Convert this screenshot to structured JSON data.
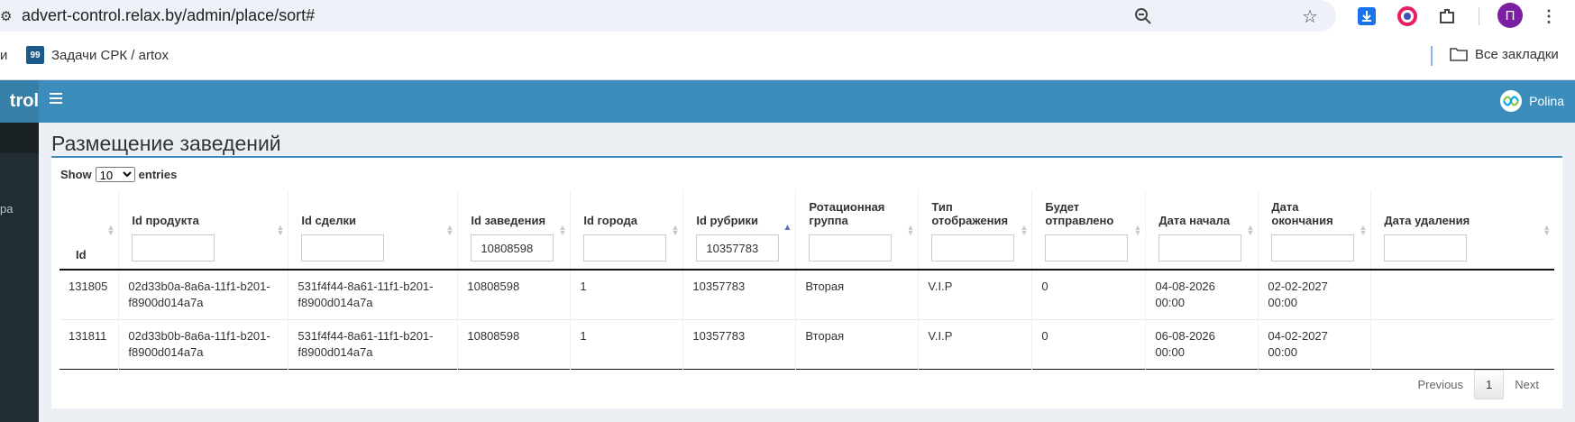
{
  "browser": {
    "url": "advert-control.relax.by/admin/place/sort#",
    "profile_initial": "П",
    "bookmarks": {
      "prev_fragment": "и",
      "item_label": "Задачи СРК / artox",
      "item_favicon_text": "99",
      "all_label": "Все закладки"
    }
  },
  "app": {
    "logo_fragment": "trol",
    "user_name": "Polina",
    "sidebar_item_fragment": "ра"
  },
  "page": {
    "title": "Размещение заведений",
    "show_label": "Show",
    "entries_label": "entries",
    "page_length": "10"
  },
  "table": {
    "headers": [
      {
        "label": "Id"
      },
      {
        "label": "Id продукта",
        "filter": ""
      },
      {
        "label": "Id сделки",
        "filter": ""
      },
      {
        "label": "Id заведения",
        "filter": "10808598"
      },
      {
        "label": "Id города",
        "filter": ""
      },
      {
        "label": "Id рубрики",
        "filter": "10357783"
      },
      {
        "label": "Ротационная группа",
        "filter": ""
      },
      {
        "label": "Тип отображения",
        "filter": ""
      },
      {
        "label": "Будет отправлено",
        "filter": ""
      },
      {
        "label": "Дата начала",
        "filter": ""
      },
      {
        "label": "Дата окончания",
        "filter": ""
      },
      {
        "label": "Дата удаления",
        "filter": ""
      }
    ],
    "rows": [
      [
        "131805",
        "02d33b0a-8a6a-11f1-b201-f8900d014a7a",
        "531f4f44-8a61-11f1-b201-f8900d014a7a",
        "10808598",
        "1",
        "10357783",
        "Вторая",
        "V.I.P",
        "0",
        "04-08-2026 00:00",
        "02-02-2027 00:00",
        ""
      ],
      [
        "131811",
        "02d33b0b-8a6a-11f1-b201-f8900d014a7a",
        "531f4f44-8a61-11f1-b201-f8900d014a7a",
        "10808598",
        "1",
        "10357783",
        "Вторая",
        "V.I.P",
        "0",
        "06-08-2026 00:00",
        "04-02-2027 00:00",
        ""
      ]
    ]
  },
  "pagination": {
    "previous": "Previous",
    "current": "1",
    "next": "Next"
  },
  "colors": {
    "header": "#3c8dbc",
    "sidebar": "#222d32",
    "content_bg": "#ecf0f5"
  }
}
